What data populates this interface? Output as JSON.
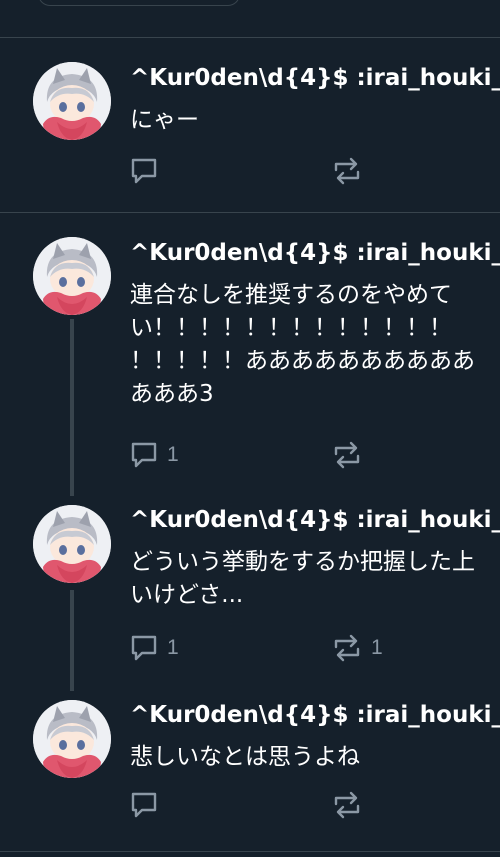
{
  "tweets": [
    {
      "author": "^Kur0den\\d{4}$ :irai_houki_",
      "text": "にゃー",
      "reply_count": "",
      "repost_count": ""
    },
    {
      "author": "^Kur0den\\d{4}$ :irai_houki_",
      "text": "連合なしを推奨するのをやめて\nい！！！！！！！！！！！！！\n！！！！！ああああああああああ\nあああ3",
      "reply_count": "1",
      "repost_count": ""
    },
    {
      "author": "^Kur0den\\d{4}$ :irai_houki_",
      "text": "どういう挙動をするか把握した上\nいけどさ...",
      "reply_count": "1",
      "repost_count": "1"
    },
    {
      "author": "^Kur0den\\d{4}$ :irai_houki_",
      "text": "悲しいなとは思うよね",
      "reply_count": "",
      "repost_count": ""
    }
  ],
  "icons": {
    "reply": "reply-icon",
    "repost": "repost-icon"
  },
  "colors": {
    "background": "#15202b",
    "divider": "#38444d",
    "text": "#ffffff",
    "muted": "#8b98a5"
  }
}
